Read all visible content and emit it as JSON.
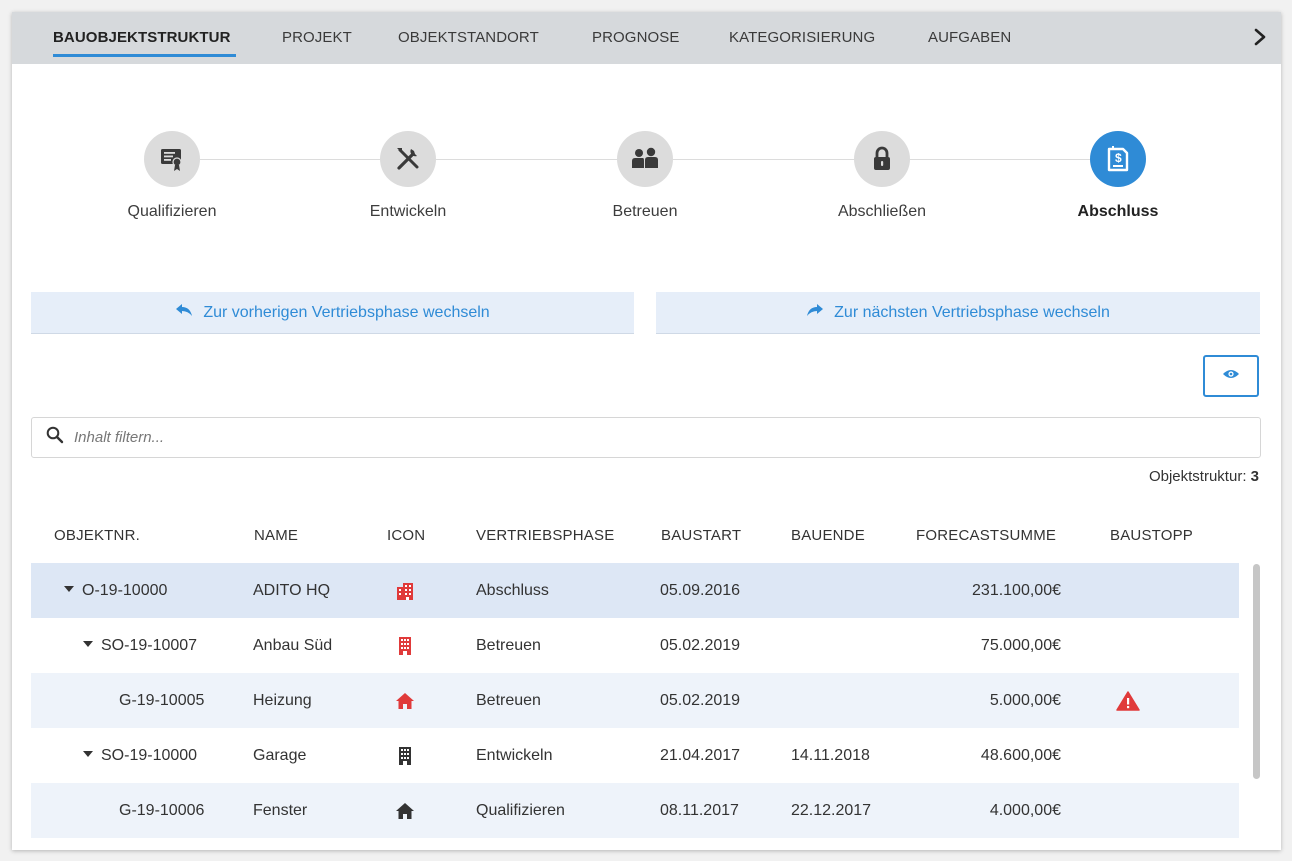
{
  "tabs": [
    {
      "label": "BAUOBJEKTSTRUKTUR",
      "active": true
    },
    {
      "label": "PROJEKT",
      "active": false
    },
    {
      "label": "OBJEKTSTANDORT",
      "active": false
    },
    {
      "label": "PROGNOSE",
      "active": false
    },
    {
      "label": "KATEGORISIERUNG",
      "active": false
    },
    {
      "label": "AUFGABEN",
      "active": false
    }
  ],
  "steps": [
    {
      "label": "Qualifizieren",
      "icon": "certificate-icon",
      "active": false
    },
    {
      "label": "Entwickeln",
      "icon": "tools-icon",
      "active": false
    },
    {
      "label": "Betreuen",
      "icon": "users-icon",
      "active": false
    },
    {
      "label": "Abschließen",
      "icon": "lock-icon",
      "active": false
    },
    {
      "label": "Abschluss",
      "icon": "invoice-icon",
      "active": true
    }
  ],
  "buttons": {
    "previous_phase": "Zur vorherigen Vertriebsphase wechseln",
    "next_phase": "Zur nächsten Vertriebsphase wechseln"
  },
  "filter": {
    "placeholder": "Inhalt filtern..."
  },
  "count": {
    "label": "Objektstruktur:",
    "value": "3"
  },
  "table": {
    "headers": [
      "OBJEKTNR.",
      "NAME",
      "ICON",
      "VERTRIEBSPHASE",
      "BAUSTART",
      "BAUENDE",
      "FORECASTSUMME",
      "BAUSTOPP"
    ],
    "rows": [
      {
        "objektnr": "O-19-10000",
        "name": "ADITO HQ",
        "icon": "office-building-icon",
        "icon_color": "#e03a3a",
        "phase": "Abschluss",
        "baustart": "05.09.2016",
        "bauende": "",
        "forecast": "231.100,00€",
        "baustopp": false,
        "expandable": true,
        "level": 0
      },
      {
        "objektnr": "SO-19-10007",
        "name": "Anbau Süd",
        "icon": "building-icon",
        "icon_color": "#e03a3a",
        "phase": "Betreuen",
        "baustart": "05.02.2019",
        "bauende": "",
        "forecast": "75.000,00€",
        "baustopp": false,
        "expandable": true,
        "level": 1
      },
      {
        "objektnr": "G-19-10005",
        "name": "Heizung",
        "icon": "house-icon",
        "icon_color": "#e03a3a",
        "phase": "Betreuen",
        "baustart": "05.02.2019",
        "bauende": "",
        "forecast": "5.000,00€",
        "baustopp": true,
        "expandable": false,
        "level": 2
      },
      {
        "objektnr": "SO-19-10000",
        "name": "Garage",
        "icon": "building-icon",
        "icon_color": "#333333",
        "phase": "Entwickeln",
        "baustart": "21.04.2017",
        "bauende": "14.11.2018",
        "forecast": "48.600,00€",
        "baustopp": false,
        "expandable": true,
        "level": 1
      },
      {
        "objektnr": "G-19-10006",
        "name": "Fenster",
        "icon": "house-icon",
        "icon_color": "#333333",
        "phase": "Qualifizieren",
        "baustart": "08.11.2017",
        "bauende": "22.12.2017",
        "forecast": "4.000,00€",
        "baustopp": false,
        "expandable": false,
        "level": 2
      }
    ]
  },
  "colors": {
    "accent": "#2f8bd6",
    "alert": "#e03a3a",
    "tabbar": "#d6d9dc"
  }
}
